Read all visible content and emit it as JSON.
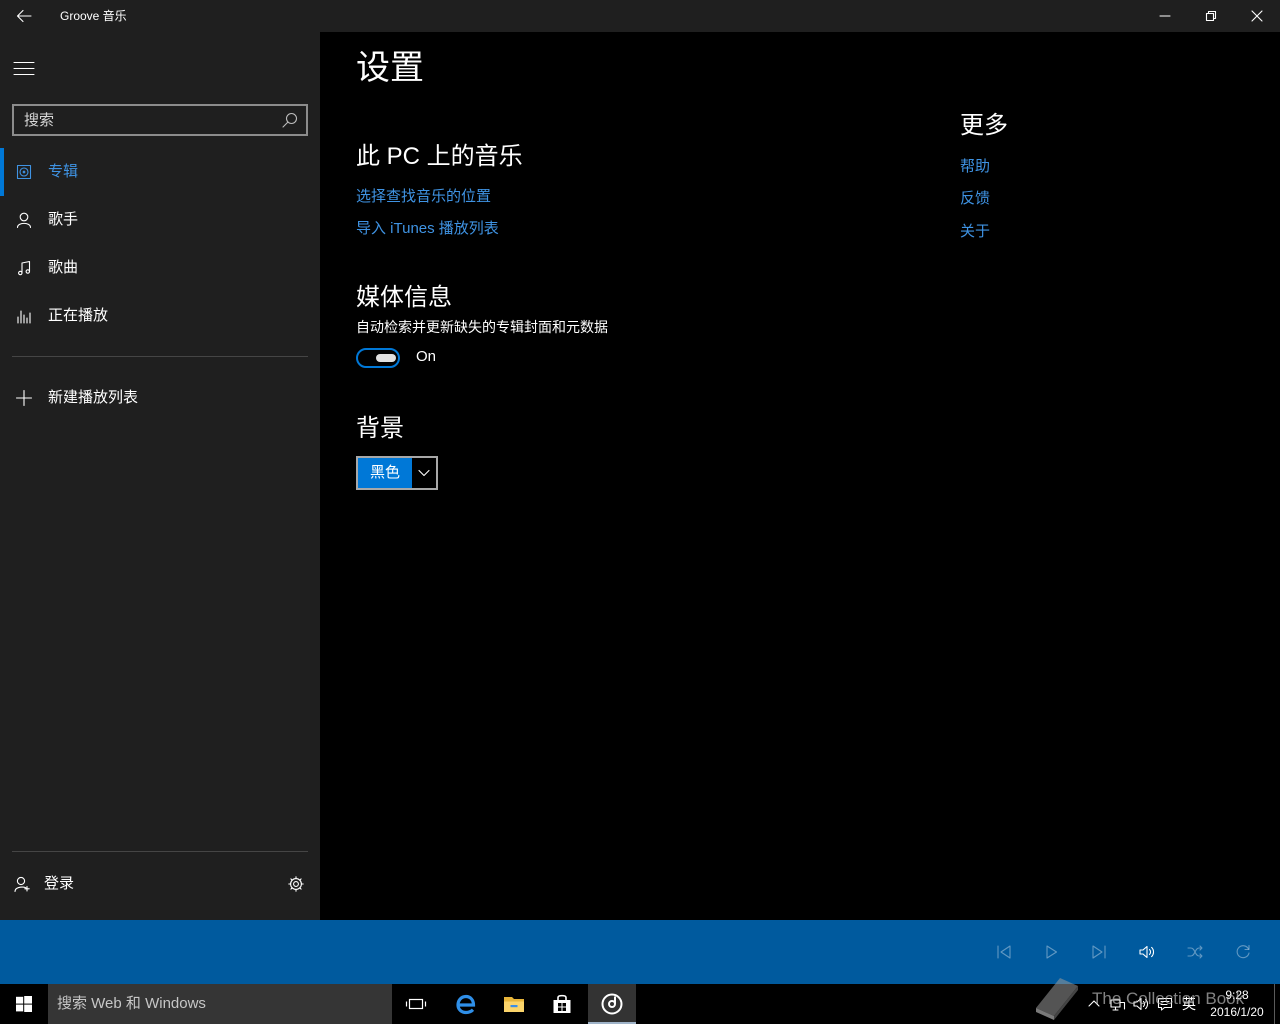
{
  "window": {
    "title": "Groove 音乐",
    "back_icon": "back-arrow-icon",
    "controls": [
      "minimize-icon",
      "restore-icon",
      "close-icon"
    ]
  },
  "colors": {
    "accent": "#0078d7",
    "link": "#3f93e3",
    "pane": "#1f1f1f",
    "content": "#000000",
    "player_bar": "#005a9e",
    "taskbar": "#000000"
  },
  "sidebar": {
    "menu_icon": "hamburger-icon",
    "search": {
      "placeholder": "搜索",
      "icon": "search-icon"
    },
    "nav": [
      {
        "label": "专辑",
        "icon": "album-icon",
        "selected": true
      },
      {
        "label": "歌手",
        "icon": "artist-icon",
        "selected": false
      },
      {
        "label": "歌曲",
        "icon": "music-note-icon",
        "selected": false
      },
      {
        "label": "正在播放",
        "icon": "now-playing-icon",
        "selected": false
      }
    ],
    "new_playlist": {
      "label": "新建播放列表",
      "icon": "plus-icon"
    },
    "account": {
      "label": "登录",
      "icon": "sign-in-icon",
      "settings_icon": "gear-icon"
    }
  },
  "settings": {
    "title": "设置",
    "music_on_pc": {
      "heading": "此 PC 上的音乐",
      "links": [
        "选择查找音乐的位置",
        "导入 iTunes 播放列表"
      ]
    },
    "media_info": {
      "heading": "媒体信息",
      "description": "自动检索并更新缺失的专辑封面和元数据",
      "toggle_on": true,
      "toggle_label": "On"
    },
    "background": {
      "heading": "背景",
      "selected": "黑色"
    },
    "more": {
      "heading": "更多",
      "links": [
        "帮助",
        "反馈",
        "关于"
      ]
    }
  },
  "player": {
    "controls": [
      {
        "icon": "previous-icon",
        "enabled": false
      },
      {
        "icon": "play-icon",
        "enabled": false
      },
      {
        "icon": "next-icon",
        "enabled": false
      },
      {
        "icon": "volume-icon",
        "enabled": true
      },
      {
        "icon": "shuffle-icon",
        "enabled": false
      },
      {
        "icon": "repeat-icon",
        "enabled": false
      }
    ]
  },
  "taskbar": {
    "start_icon": "windows-logo-icon",
    "search_placeholder": "搜索 Web 和 Windows",
    "buttons": [
      {
        "icon": "task-view-icon",
        "active": false
      },
      {
        "icon": "edge-icon",
        "active": false
      },
      {
        "icon": "file-explorer-icon",
        "active": false
      },
      {
        "icon": "store-icon",
        "active": false
      },
      {
        "icon": "groove-music-icon",
        "active": true
      }
    ],
    "tray": {
      "icons": [
        "chevron-up-icon",
        "network-icon",
        "volume-icon",
        "action-center-icon"
      ],
      "ime": "英",
      "time": "9:28",
      "date": "2016/1/20"
    }
  },
  "watermark": {
    "text": "The Collection Book",
    "icon": "book-icon"
  }
}
